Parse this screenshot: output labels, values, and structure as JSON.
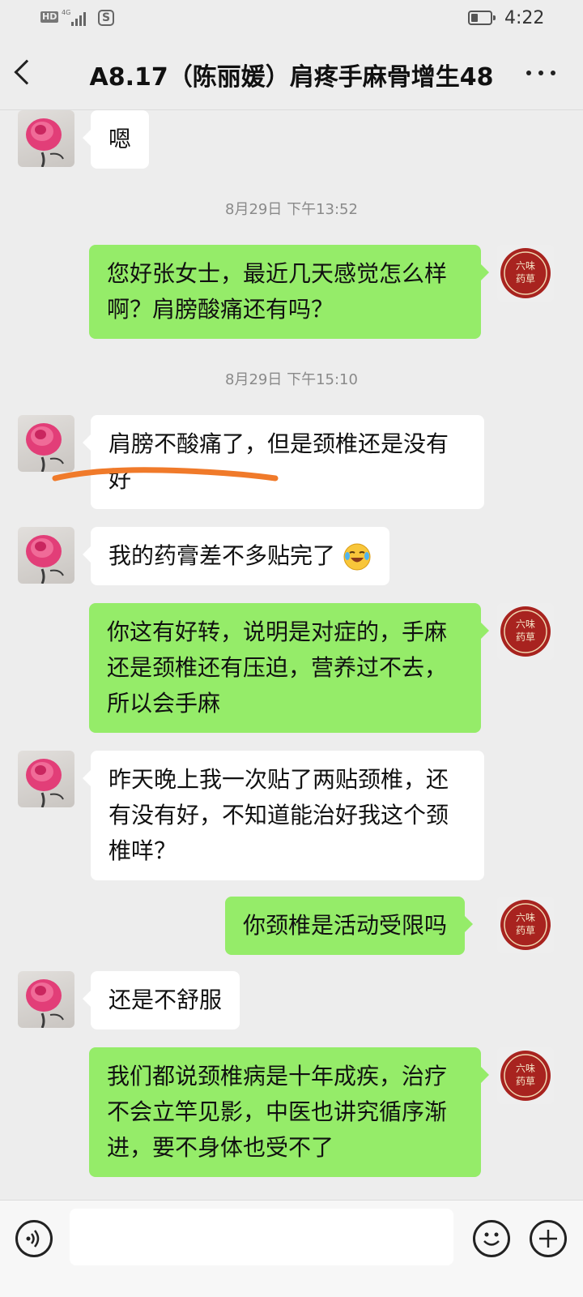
{
  "status_bar": {
    "hd": "HD",
    "network": "4G",
    "app_badge": "S",
    "time": "4:22"
  },
  "header": {
    "title": "A8.17（陈丽媛）肩疼手麻骨增生48"
  },
  "messages": [
    {
      "type": "in",
      "text": "嗯"
    },
    {
      "type": "timestamp",
      "text": "8月29日 下午13:52"
    },
    {
      "type": "out",
      "text": "您好张女士，最近几天感觉怎么样啊？肩膀酸痛还有吗？"
    },
    {
      "type": "timestamp",
      "text": "8月29日 下午15:10"
    },
    {
      "type": "in",
      "text": "肩膀不酸痛了，但是颈椎还是没有好"
    },
    {
      "type": "in",
      "text": "我的药膏差不多贴完了"
    },
    {
      "type": "out",
      "text": "你这有好转，说明是对症的，手麻还是颈椎还有压迫，营养过不去，所以会手麻"
    },
    {
      "type": "in",
      "text": "昨天晚上我一次贴了两贴颈椎，还有没有好，不知道能治好我这个颈椎咩？"
    },
    {
      "type": "out",
      "text": "你颈椎是活动受限吗"
    },
    {
      "type": "in",
      "text": "还是不舒服"
    },
    {
      "type": "out",
      "text": "我们都说颈椎病是十年成疾，治疗不会立竿见影，中医也讲究循序渐进，要不身体也受不了"
    }
  ],
  "shop_avatar_label": [
    "六",
    "味",
    "药",
    "草"
  ],
  "icons": {
    "back": "chevron-left-icon",
    "more": "more-dots-icon",
    "voice": "voice-icon",
    "emoji": "emoji-icon",
    "plus": "plus-icon",
    "reaction": "crying-laughing-emoji"
  },
  "colors": {
    "background": "#ededed",
    "outgoing_bubble": "#95ec69",
    "incoming_bubble": "#ffffff",
    "underline_mark": "#f07a2a"
  },
  "input": {
    "value": ""
  }
}
